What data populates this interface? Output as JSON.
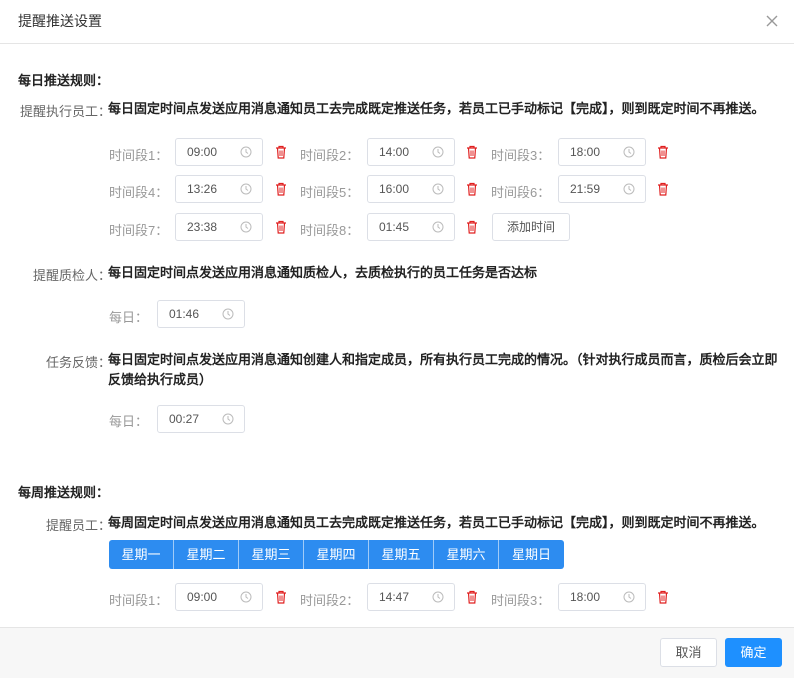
{
  "dialog": {
    "title": "提醒推送设置"
  },
  "daily": {
    "section_title": "每日推送规则：",
    "staff": {
      "label": "提醒执行员工：",
      "desc": "每日固定时间点发送应用消息通知员工去完成既定推送任务，若员工已手动标记【完成】，则到既定时间不再推送。",
      "slots": [
        {
          "label": "时间段1：",
          "time": "09:00"
        },
        {
          "label": "时间段2：",
          "time": "14:00"
        },
        {
          "label": "时间段3：",
          "time": "18:00"
        },
        {
          "label": "时间段4：",
          "time": "13:26"
        },
        {
          "label": "时间段5：",
          "time": "16:00"
        },
        {
          "label": "时间段6：",
          "time": "21:59"
        },
        {
          "label": "时间段7：",
          "time": "23:38"
        },
        {
          "label": "时间段8：",
          "time": "01:45"
        }
      ],
      "add_button": "添加时间"
    },
    "inspector": {
      "label": "提醒质检人：",
      "desc": "每日固定时间点发送应用消息通知质检人，去质检执行的员工任务是否达标",
      "daily_label": "每日：",
      "time": "01:46"
    },
    "feedback": {
      "label": "任务反馈：",
      "desc_line1": "每日固定时间点发送应用消息通知创建人和指定成员，所有执行员工完成的情况。（针对执行成员而言，质检后会立即",
      "desc_line2": "反馈给执行成员）",
      "daily_label": "每日：",
      "time": "00:27"
    }
  },
  "weekly": {
    "section_title": "每周推送规则：",
    "staff": {
      "label": "提醒员工：",
      "desc": "每周固定时间点发送应用消息通知员工去完成既定推送任务，若员工已手动标记【完成】，则到既定时间不再推送。",
      "days": [
        "星期一",
        "星期二",
        "星期三",
        "星期四",
        "星期五",
        "星期六",
        "星期日"
      ],
      "slots": [
        {
          "label": "时间段1：",
          "time": "09:00"
        },
        {
          "label": "时间段2：",
          "time": "14:47"
        },
        {
          "label": "时间段3：",
          "time": "18:00"
        }
      ]
    }
  },
  "footer": {
    "cancel": "取消",
    "ok": "确定"
  },
  "colors": {
    "primary": "#1e90ff",
    "danger": "#e02020",
    "week_bar": "#2d8cf0"
  },
  "icons": {
    "close": "close-icon",
    "clock": "clock-icon",
    "trash": "trash-icon"
  }
}
